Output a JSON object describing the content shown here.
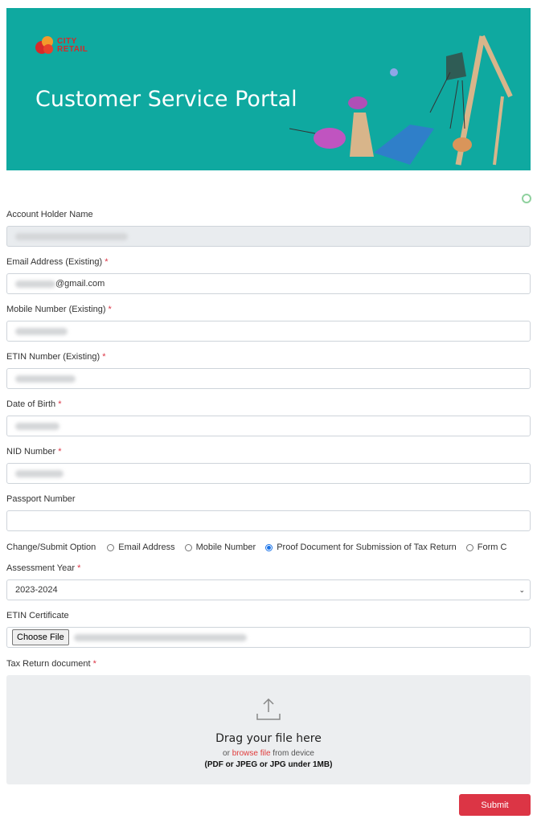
{
  "banner": {
    "logo_line1": "CITY",
    "logo_line2": "RETAIL",
    "title": "Customer Service Portal",
    "brand_color": "#0fa9a0"
  },
  "form": {
    "account_holder": {
      "label": "Account Holder Name",
      "value": ""
    },
    "email": {
      "label": "Email Address (Existing)",
      "required": "*",
      "value_suffix": "@gmail.com"
    },
    "mobile": {
      "label": "Mobile Number (Existing)",
      "required": "*"
    },
    "etin": {
      "label": "ETIN Number (Existing)",
      "required": "*"
    },
    "dob": {
      "label": "Date of Birth",
      "required": "*"
    },
    "nid": {
      "label": "NID Number",
      "required": "*"
    },
    "passport": {
      "label": "Passport Number",
      "value": ""
    },
    "option": {
      "label": "Change/Submit Option",
      "choices": [
        "Email Address",
        "Mobile Number",
        "Proof Document for Submission of Tax Return",
        "Form C"
      ],
      "selected": "Proof Document for Submission of Tax Return"
    },
    "assessment_year": {
      "label": "Assessment Year",
      "required": "*",
      "value": "2023-2024"
    },
    "etin_certificate": {
      "label": "ETIN Certificate",
      "button": "Choose File"
    },
    "tax_return": {
      "label": "Tax Return document",
      "required": "*",
      "drag_text": "Drag your file here",
      "or": "or",
      "browse": "browse file",
      "from_device": "from device",
      "formats": "(PDF or JPEG or JPG under 1MB)"
    },
    "submit": "Submit"
  },
  "colors": {
    "accent": "#dc3545",
    "radio": "#1a73e8"
  }
}
